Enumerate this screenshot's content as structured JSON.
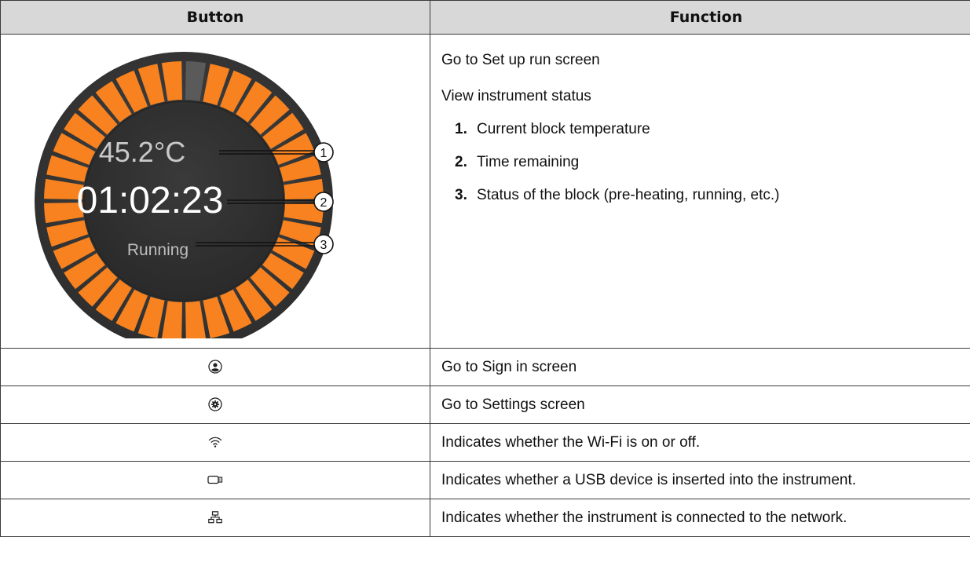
{
  "table": {
    "headers": [
      "Button",
      "Function"
    ],
    "main_row": {
      "dial": {
        "temperature": "45.2°C",
        "time": "01:02:23",
        "status": "Running",
        "progress_fraction": 0.97,
        "callouts": [
          "1",
          "2",
          "3"
        ],
        "colors": {
          "ring": "#f7821f",
          "bezel": "#3d3d3d",
          "face": "#333333",
          "segment_gap": "#5a5a5a"
        }
      },
      "lines": [
        "Go to Set up run screen",
        "View instrument status"
      ],
      "items": [
        {
          "num": "1.",
          "text": "Current block temperature"
        },
        {
          "num": "2.",
          "text": "Time remaining"
        },
        {
          "num": "3.",
          "text": "Status of the block (pre-heating, running, etc.)"
        }
      ]
    },
    "rows": [
      {
        "icon": "user-icon",
        "text": "Go to Sign in screen"
      },
      {
        "icon": "gear-icon",
        "text": "Go to Settings screen"
      },
      {
        "icon": "wifi-icon",
        "text": "Indicates whether the Wi-Fi is on or off."
      },
      {
        "icon": "usb-icon",
        "text": "Indicates whether a USB device is inserted into the instrument."
      },
      {
        "icon": "network-icon",
        "text": "Indicates whether the instrument is connected to the network."
      }
    ]
  }
}
